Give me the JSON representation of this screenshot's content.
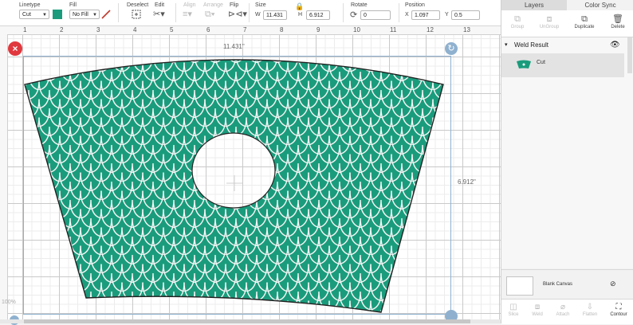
{
  "toolbar": {
    "linetype": {
      "label": "Linetype",
      "value": "Cut"
    },
    "fill": {
      "label": "Fill",
      "value": "No Fill"
    },
    "deselect": {
      "label": "Deselect"
    },
    "edit": {
      "label": "Edit"
    },
    "align": {
      "label": "Align"
    },
    "arrange": {
      "label": "Arrange"
    },
    "flip": {
      "label": "Flip"
    },
    "size": {
      "label": "Size",
      "w_label": "W",
      "w_value": "11.431",
      "h_label": "H",
      "h_value": "6.912"
    },
    "rotate": {
      "label": "Rotate",
      "value": "0"
    },
    "position": {
      "label": "Position",
      "x_label": "X",
      "x_value": "1.097",
      "y_label": "Y",
      "y_value": "0.5"
    },
    "colors": {
      "swatch": "#1a9c7c",
      "pen": "#c0392b"
    }
  },
  "ruler": {
    "numbers": [
      "1",
      "2",
      "3",
      "4",
      "5",
      "6",
      "7",
      "8",
      "9",
      "10",
      "11",
      "12",
      "13"
    ]
  },
  "canvas": {
    "width_readout": "11.431\"",
    "height_readout": "6.912\"",
    "zoom": "100%",
    "design_fill": "#1a9c7c"
  },
  "panel": {
    "tabs": [
      "Layers",
      "Color Sync"
    ],
    "actions": [
      "Group",
      "UnGroup",
      "Duplicate",
      "Delete"
    ],
    "group_label": "Weld Result",
    "layer_label": "Cut",
    "blank_canvas": "Blank Canvas",
    "bottom_actions": [
      "Slice",
      "Weld",
      "Attach",
      "Flatten",
      "Contour"
    ]
  }
}
